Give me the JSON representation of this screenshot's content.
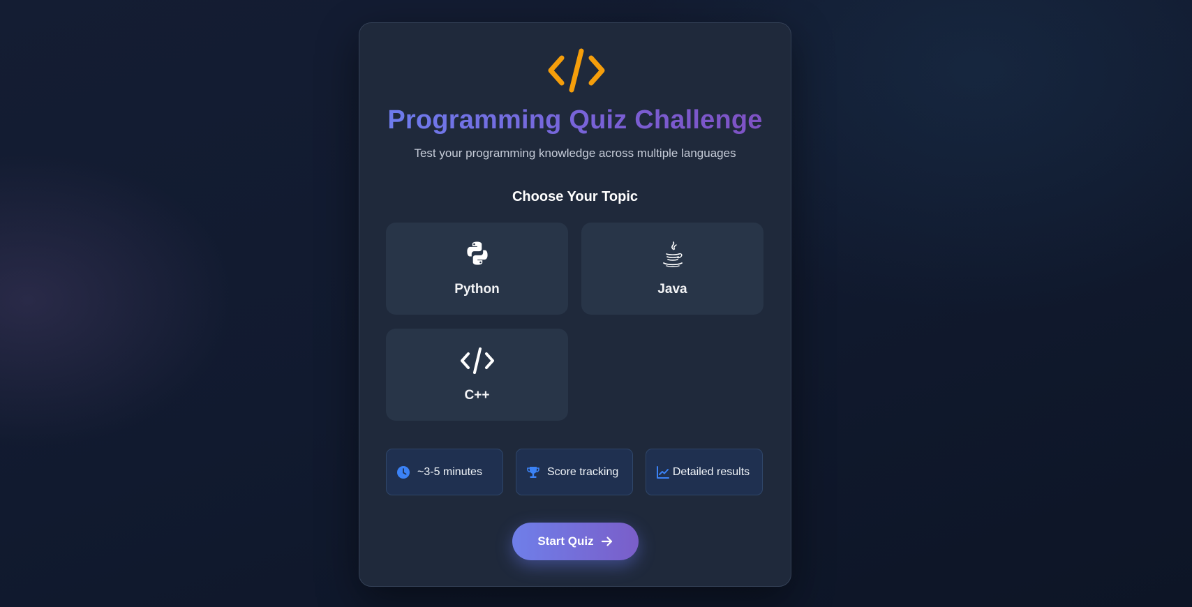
{
  "header": {
    "logo_icon": "code-brackets-icon",
    "title": "Programming Quiz Challenge",
    "subtitle": "Test your programming knowledge across multiple languages"
  },
  "topics": {
    "heading": "Choose Your Topic",
    "items": [
      {
        "label": "Python",
        "icon": "python-icon"
      },
      {
        "label": "Java",
        "icon": "java-icon"
      },
      {
        "label": "C++",
        "icon": "code-icon"
      }
    ]
  },
  "features": [
    {
      "label": "~3-5 minutes",
      "icon": "clock-icon"
    },
    {
      "label": "Score tracking",
      "icon": "trophy-icon"
    },
    {
      "label": "Detailed results",
      "icon": "chart-line-icon"
    }
  ],
  "actions": {
    "start_label": "Start Quiz",
    "start_icon": "arrow-right-icon"
  },
  "colors": {
    "accent_orange": "#f59e0b",
    "gradient_start": "#6c7ff0",
    "gradient_end": "#7f4fc0",
    "feature_icon": "#3b82f6",
    "card_bg": "#1f293b"
  }
}
